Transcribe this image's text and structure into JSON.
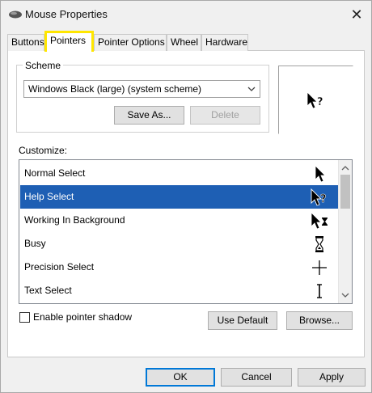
{
  "window": {
    "title": "Mouse Properties",
    "close_symbol": "✕",
    "icon": "mouse-icon"
  },
  "tabs": [
    {
      "label": "Buttons",
      "active": false
    },
    {
      "label": "Pointers",
      "active": true
    },
    {
      "label": "Pointer Options",
      "active": false
    },
    {
      "label": "Wheel",
      "active": false
    },
    {
      "label": "Hardware",
      "active": false
    }
  ],
  "scheme": {
    "group_label": "Scheme",
    "selected": "Windows Black (large) (system scheme)",
    "save_as_label": "Save As...",
    "delete_label": "Delete"
  },
  "preview": {
    "icon": "help-select-cursor-icon"
  },
  "customize": {
    "label": "Customize:",
    "items": [
      {
        "label": "Normal Select",
        "icon": "arrow-cursor-icon",
        "selected": false
      },
      {
        "label": "Help Select",
        "icon": "help-cursor-icon",
        "selected": true
      },
      {
        "label": "Working In Background",
        "icon": "working-cursor-icon",
        "selected": false
      },
      {
        "label": "Busy",
        "icon": "hourglass-cursor-icon",
        "selected": false
      },
      {
        "label": "Precision Select",
        "icon": "crosshair-cursor-icon",
        "selected": false
      },
      {
        "label": "Text Select",
        "icon": "ibeam-cursor-icon",
        "selected": false
      }
    ]
  },
  "shadow": {
    "label": "Enable pointer shadow",
    "checked": false
  },
  "buttons": {
    "use_default": "Use Default",
    "browse": "Browse...",
    "ok": "OK",
    "cancel": "Cancel",
    "apply": "Apply"
  },
  "colors": {
    "selection": "#1e5fb4",
    "highlight_border": "#ffe600",
    "default_button_border": "#0078d7"
  }
}
